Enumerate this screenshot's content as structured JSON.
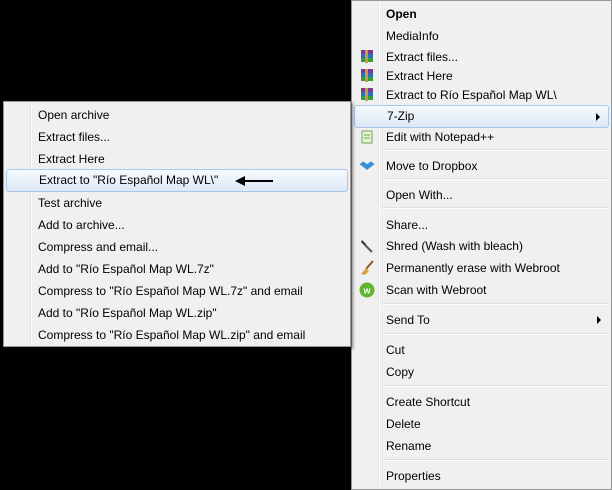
{
  "main_menu": {
    "items": {
      "open": "Open",
      "mediainfo": "MediaInfo",
      "extract_files": "Extract files...",
      "extract_here": "Extract Here",
      "extract_to": "Extract to Río Español Map WL\\",
      "seven_zip": "7-Zip",
      "edit_notepad": "Edit with Notepad++",
      "dropbox": "Move to Dropbox",
      "open_with": "Open With...",
      "share": "Share...",
      "shred": "Shred (Wash with bleach)",
      "erase_webroot": "Permanently erase with Webroot",
      "scan_webroot": "Scan with Webroot",
      "send_to": "Send To",
      "cut": "Cut",
      "copy": "Copy",
      "create_shortcut": "Create Shortcut",
      "delete": "Delete",
      "rename": "Rename",
      "properties": "Properties"
    }
  },
  "submenu_7zip": {
    "items": [
      "Open archive",
      "Extract files...",
      "Extract Here",
      "Extract to \"Río Español Map WL\\\"",
      "Test archive",
      "Add to archive...",
      "Compress and email...",
      "Add to \"Río Español Map WL.7z\"",
      "Compress to \"Río Español Map WL.7z\" and email",
      "Add to \"Río Español Map WL.zip\"",
      "Compress to \"Río Español Map WL.zip\" and email"
    ],
    "highlighted_index": 3
  },
  "colors": {
    "menu_bg": "#f0f0f0",
    "highlight_border": "#a8c8eb",
    "webroot_green": "#5fb52b"
  }
}
